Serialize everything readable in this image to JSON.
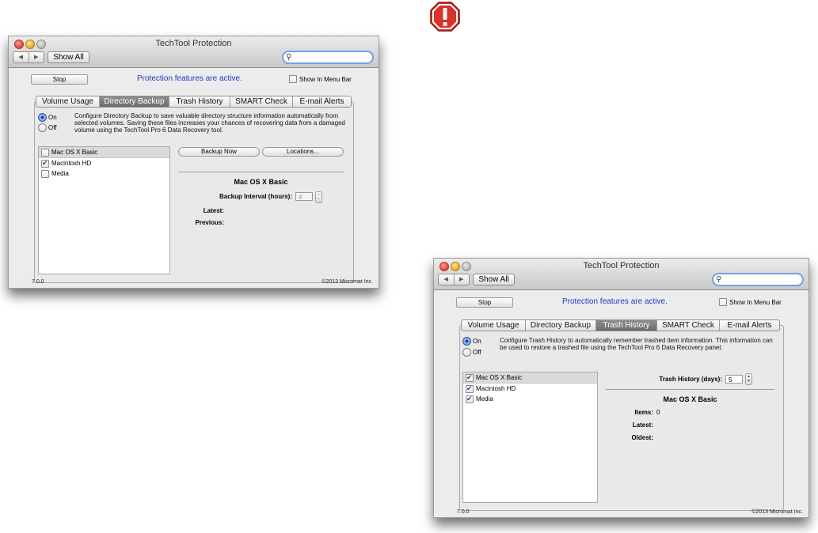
{
  "colors": {
    "status_text": "#2236c8",
    "alert_red": "#d9322b",
    "selected_tab": "#7b7b7b"
  },
  "icons": {
    "alert": "exclamation-octagon-icon",
    "nav_back": "chevron-left-icon",
    "nav_forward": "chevron-right-icon",
    "search": "magnifier-icon",
    "check": "checkmark-icon"
  },
  "window1": {
    "title": "TechTool Protection",
    "show_all": "Show All",
    "stop": "Stop",
    "status": "Protection features are active.",
    "show_menu_bar": "Show In Menu Bar",
    "tabs": [
      "Volume Usage",
      "Directory Backup",
      "Trash History",
      "SMART Check",
      "E-mail Alerts"
    ],
    "active_tab": "Directory Backup",
    "radio_on": "On",
    "radio_off": "Off",
    "description": "Configure Directory Backup to save valuable directory structure information automatically from selected volumes. Saving these files increases your chances of recovering data from a damaged volume using the TechTool Pro 6 Data Recovery tool.",
    "volumes": [
      {
        "name": "Mac OS X Basic",
        "checked": false
      },
      {
        "name": "Macintosh HD",
        "checked": true
      },
      {
        "name": "Media",
        "checked": false
      }
    ],
    "backup_now": "Backup Now",
    "locations": "Locations...",
    "volume_title": "Mac OS X Basic",
    "interval_label": "Backup Interval (hours):",
    "interval_value": "4",
    "latest_label": "Latest:",
    "previous_label": "Previous:",
    "version": "7.0.0",
    "copyright": "©2013 Micromat Inc."
  },
  "window2": {
    "title": "TechTool Protection",
    "show_all": "Show All",
    "stop": "Stop",
    "status": "Protection features are active.",
    "show_menu_bar": "Show In Menu Bar",
    "tabs": [
      "Volume Usage",
      "Directory Backup",
      "Trash History",
      "SMART Check",
      "E-mail Alerts"
    ],
    "active_tab": "Trash History",
    "radio_on": "On",
    "radio_off": "Off",
    "description": "Configure Trash History to automatically remember trashed item information. This information can be used to restore a trashed file using the TechTool Pro 6 Data Recovery panel.",
    "volumes": [
      {
        "name": "Mac OS X Basic",
        "checked": true
      },
      {
        "name": "Macintosh HD",
        "checked": true
      },
      {
        "name": "Media",
        "checked": true
      }
    ],
    "history_label": "Trash History (days):",
    "history_value": "5",
    "volume_title": "Mac OS X Basic",
    "items_label": "Items:",
    "items_value": "0",
    "latest_label": "Latest:",
    "oldest_label": "Oldest:",
    "version": "7.0.0",
    "copyright": "©2013 Micromat Inc."
  }
}
